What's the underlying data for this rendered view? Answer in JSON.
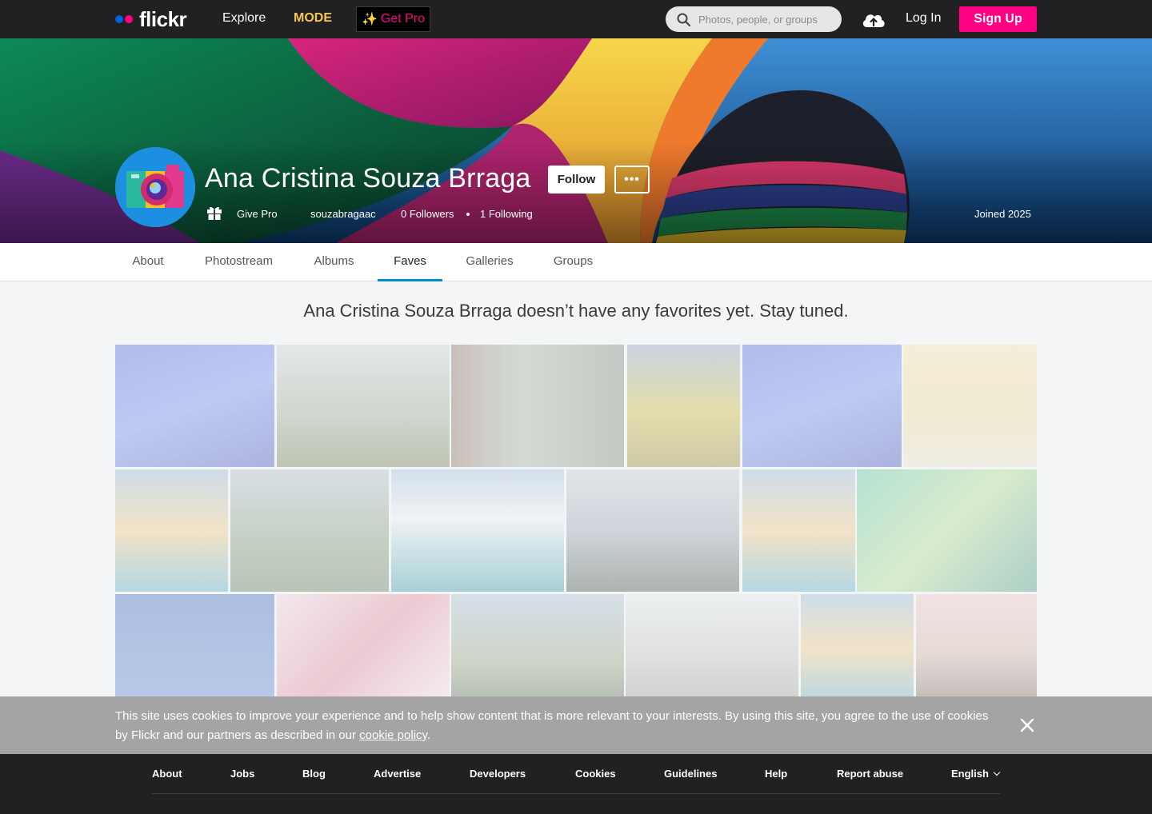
{
  "nav": {
    "logo": "flickr",
    "explore": "Explore",
    "mode": "MODE",
    "get_pro": "Get Pro",
    "search_placeholder": "Photos, people, or groups",
    "login": "Log In",
    "signup": "Sign Up"
  },
  "profile": {
    "name": "Ana Cristina Souza Brraga",
    "follow": "Follow",
    "more": "•••",
    "give_pro": "Give Pro",
    "username": "souzabragaac",
    "followers": "0 Followers",
    "following": "1 Following",
    "joined": "Joined 2025"
  },
  "tabs": [
    {
      "label": "About",
      "active": false
    },
    {
      "label": "Photostream",
      "active": false
    },
    {
      "label": "Albums",
      "active": false
    },
    {
      "label": "Faves",
      "active": true
    },
    {
      "label": "Galleries",
      "active": false
    },
    {
      "label": "Groups",
      "active": false
    }
  ],
  "content": {
    "empty_message": "Ana Cristina Souza Brraga doesn’t have any favorites yet. Stay tuned."
  },
  "cookie": {
    "text_before": "This site uses cookies to improve your experience and to help show content that is more relevant to your interests. By using this site, you agree to the use of cookies by Flickr and our partners as described in our ",
    "link": "cookie policy",
    "text_after": "."
  },
  "footer": {
    "links": [
      "About",
      "Jobs",
      "Blog",
      "Advertise",
      "Developers",
      "Cookies",
      "Guidelines",
      "Help",
      "Report abuse"
    ],
    "language": "English"
  },
  "colors": {
    "brand_pink": "#ff0084",
    "brand_blue": "#0063dc",
    "mode_yellow": "#f9c74f",
    "tab_active": "#008ecd",
    "nav_bg": "#212124"
  }
}
